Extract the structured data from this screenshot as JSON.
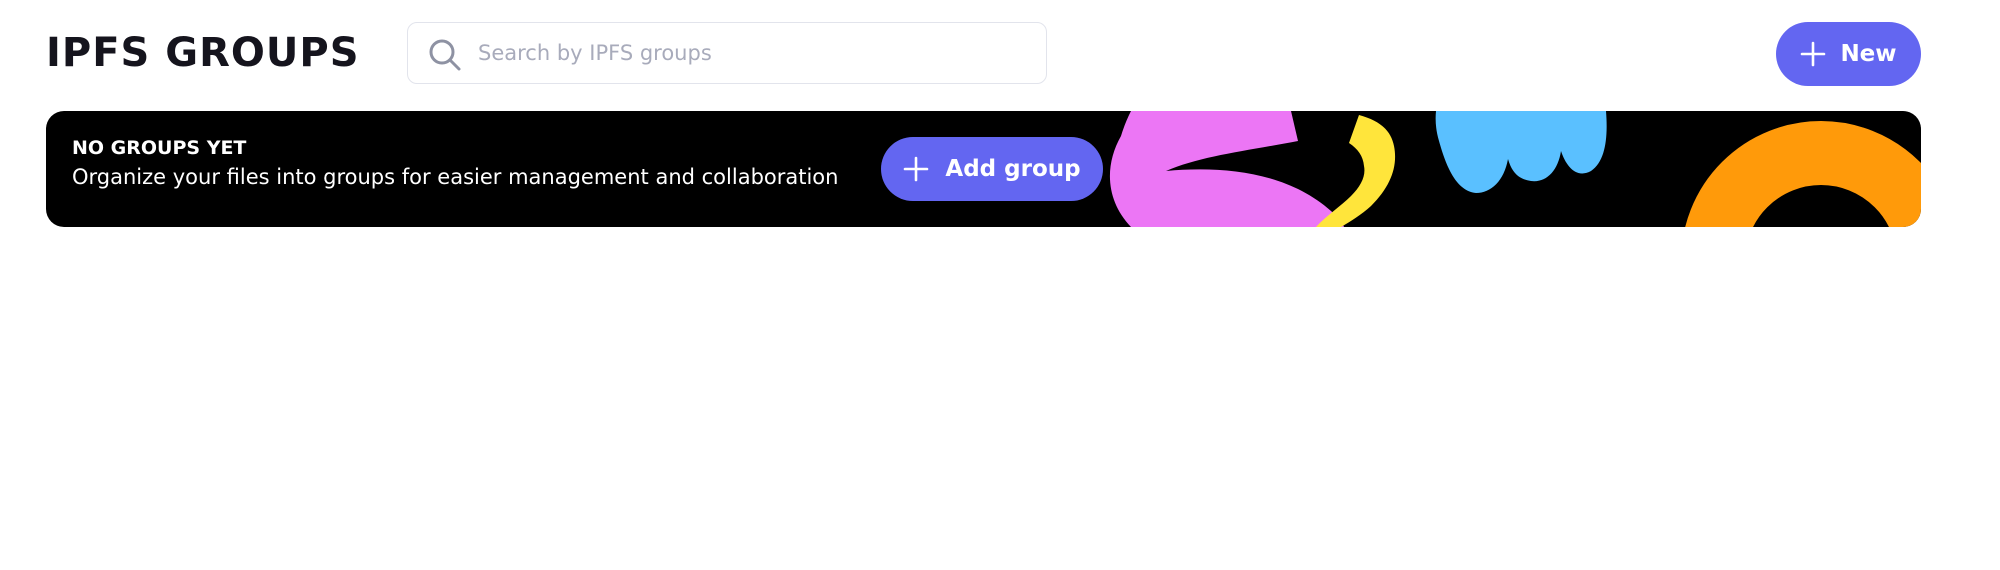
{
  "header": {
    "title": "IPFS GROUPS",
    "search": {
      "placeholder": "Search by IPFS groups",
      "value": ""
    },
    "new_button": {
      "label": "New",
      "icon": "plus-icon"
    }
  },
  "empty_banner": {
    "heading": "NO GROUPS YET",
    "description": "Organize your files into groups for easier management and collaboration",
    "add_button": {
      "label": "Add group",
      "icon": "plus-icon"
    }
  },
  "colors": {
    "accent": "#6366f1",
    "title_text": "#15141d",
    "banner_bg": "#000000",
    "shape_pink": "#ec76f5",
    "shape_yellow": "#ffe53b",
    "shape_blue": "#5ac0ff",
    "shape_orange": "#ff9a0a"
  }
}
